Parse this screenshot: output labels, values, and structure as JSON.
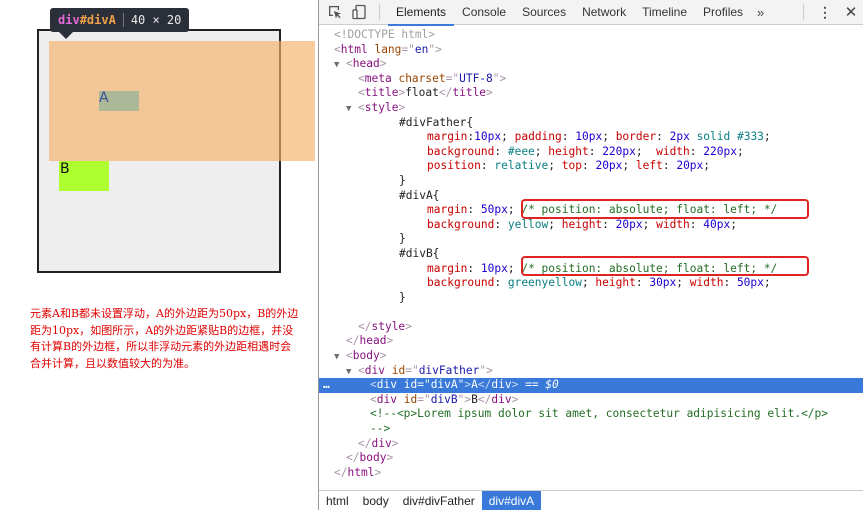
{
  "preview": {
    "tooltip": {
      "tag": "div",
      "id": "#divA",
      "size": "40 × 20"
    },
    "divA_label": "A",
    "divB_label": "B",
    "note": "元素A和B都未设置浮动，A的外边距为50px，B的外边距为10px，如图所示，A的外边距紧贴B的边框，并没有计算B的外边框，所以非浮动元素的外边距相遇时会合并计算，且以数值较大的为准。",
    "colors": {
      "father_bg": "#eeeeee",
      "father_border": "#333333",
      "divA_bg": "yellow",
      "divB_bg": "greenyellow",
      "margin_highlight": "#f6b26b",
      "note_text": "#e00000"
    }
  },
  "devtools": {
    "toolbar": {
      "inspect_icon": "inspect-element-icon",
      "device_icon": "device-toolbar-icon",
      "tabs": [
        "Elements",
        "Console",
        "Sources",
        "Network",
        "Timeline",
        "Profiles"
      ],
      "active_tab": "Elements",
      "more_tabs": "»",
      "menu_icon": "⋮",
      "close_icon": "✕"
    },
    "tree": {
      "doctype": "<!DOCTYPE html>",
      "html_open": {
        "tag": "html",
        "attr": "lang",
        "value": "en"
      },
      "head": "head",
      "meta": {
        "tag": "meta",
        "attr": "charset",
        "value": "UTF-8"
      },
      "title": {
        "tag": "title",
        "text": "float"
      },
      "style": "style",
      "css": {
        "father_sel": "#divFather{",
        "father_l1": [
          {
            "p": "margin",
            "v": "10px"
          },
          {
            "p": "padding",
            "v": "10px"
          },
          {
            "p": "border",
            "v": "2px solid #333"
          }
        ],
        "father_l1_text": {
          "p1": "margin",
          "v1": "10px",
          "p2": "padding",
          "v2": "10px",
          "p3": "border",
          "v3a": "2px",
          "v3b": "solid #333"
        },
        "father_l2_text": {
          "p1": "background",
          "v1": "#eee",
          "p2": "height",
          "v2": "220px",
          "p3": "width",
          "v3": "220px"
        },
        "father_l3_text": {
          "p1": "position",
          "v1": "relative",
          "p2": "top",
          "v2": "20px",
          "p3": "left",
          "v3": "20px"
        },
        "close_brace": "}",
        "a_sel": "#divA{",
        "a_l1": {
          "p": "margin",
          "v": "50px",
          "comment": "/* position: absolute; float: left; */"
        },
        "a_l2": {
          "p1": "background",
          "v1": "yellow",
          "p2": "height",
          "v2": "20px",
          "p3": "width",
          "v3": "40px"
        },
        "b_sel": "#divB{",
        "b_l1": {
          "p": "margin",
          "v": "10px",
          "comment": "/* position: absolute; float: left; */"
        },
        "b_l2": {
          "p1": "background",
          "v1": "greenyellow",
          "p2": "height",
          "v2": "30px",
          "p3": "width",
          "v3": "50px"
        }
      },
      "style_close": "style",
      "head_close": "head",
      "body": "body",
      "father": {
        "tag": "div",
        "attr": "id",
        "value": "divFather"
      },
      "divA": {
        "tag": "div",
        "attr": "id",
        "value": "divA",
        "text": "A",
        "console_ref": "== $0"
      },
      "divB": {
        "tag": "div",
        "attr": "id",
        "value": "divB",
        "text": "B"
      },
      "comment_l1": "<!--<p>Lorem ipsum dolor sit amet, consectetur adipisicing elit.</p>",
      "comment_l2": "-->",
      "div_close": "div",
      "body_close": "body",
      "html_close": "html",
      "gutter_dots": "…"
    },
    "breadcrumb": [
      "html",
      "body",
      "div#divFather",
      "div#divA"
    ],
    "active_crumb": "div#divA"
  }
}
